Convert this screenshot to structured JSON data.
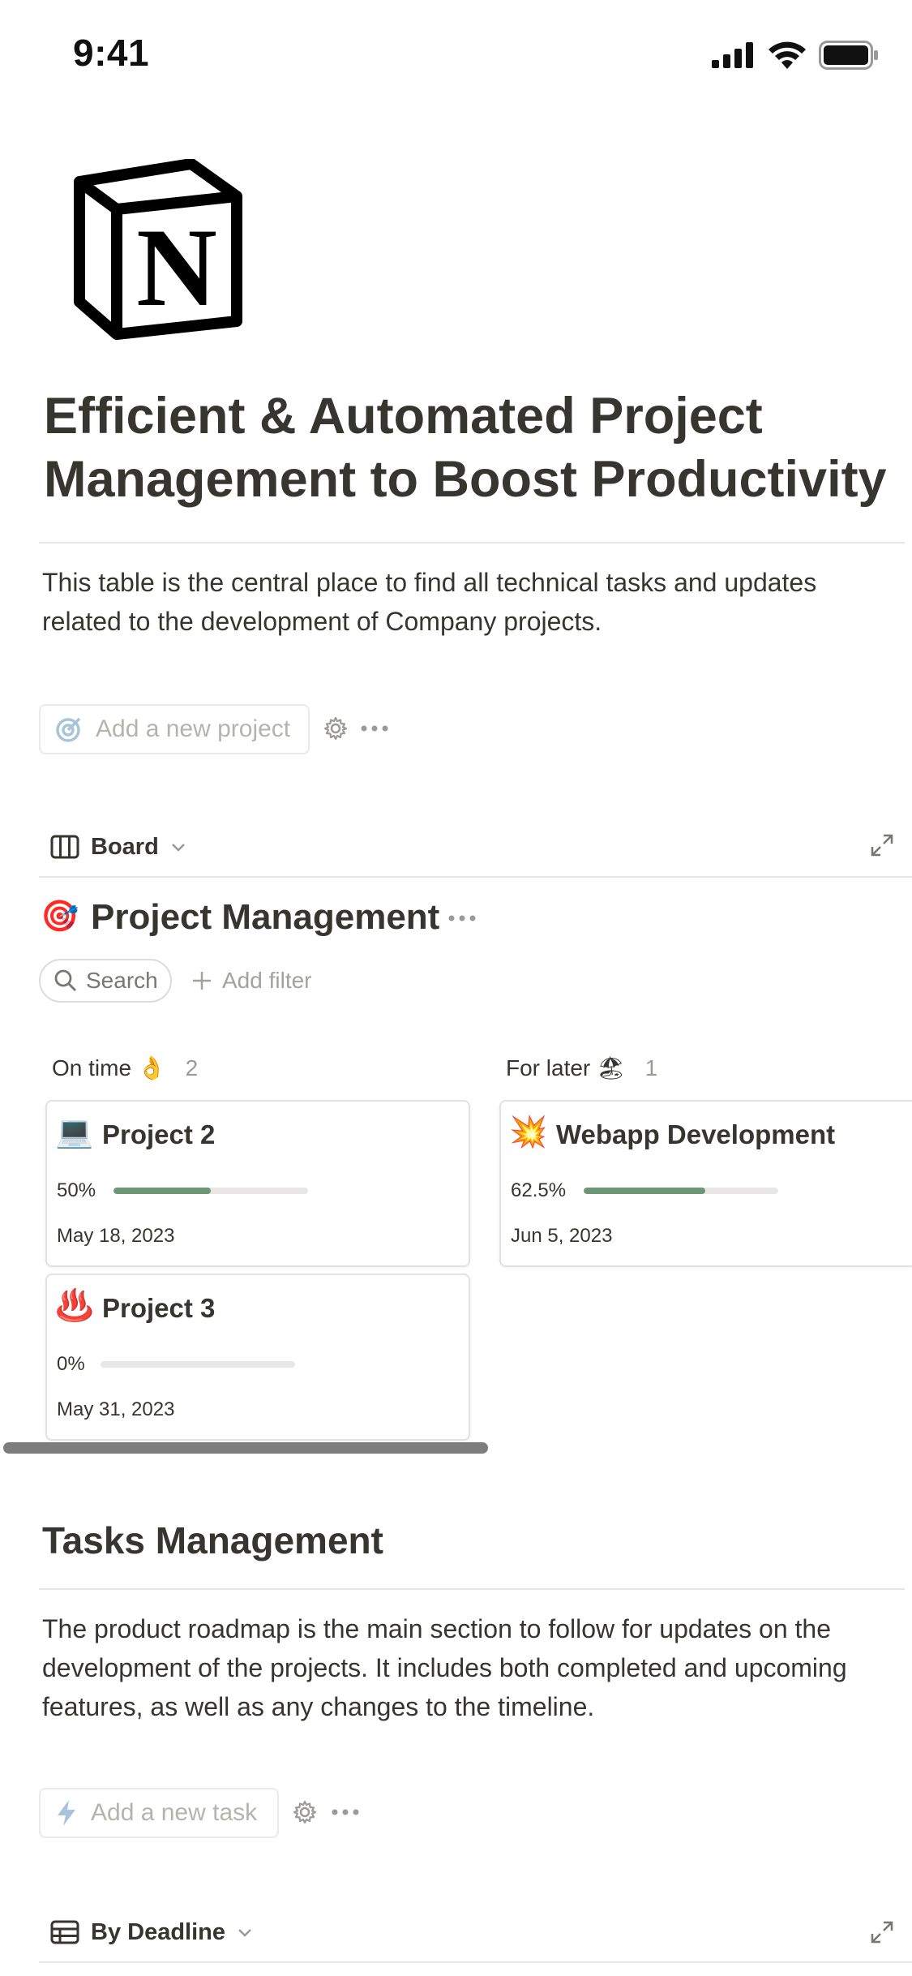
{
  "status_bar": {
    "time": "9:41"
  },
  "page": {
    "title": "Efficient & Automated Project Management to Boost Productivity",
    "description": "This table is the central place to find all technical tasks and updates related to the development of Company projects."
  },
  "projects_actions": {
    "add_label": "Add a new project"
  },
  "board_view": {
    "view_label": "Board",
    "db_icon": "🎯",
    "db_title": "Project Management",
    "search_label": "Search",
    "filter_label": "Add filter",
    "columns": [
      {
        "name": "On time 👌",
        "count": "2",
        "cards": [
          {
            "icon": "💻",
            "title": "Project 2",
            "percent_label": "50%",
            "progress": 0.5,
            "date": "May 18, 2023"
          },
          {
            "icon": "♨️",
            "title": "Project 3",
            "percent_label": "0%",
            "progress": 0,
            "date": "May 31, 2023"
          }
        ]
      },
      {
        "name": "For later 🏖",
        "count": "1",
        "cards": [
          {
            "icon": "💥",
            "title": "Webapp Development",
            "percent_label": "62.5%",
            "progress": 0.625,
            "date": "Jun 5, 2023"
          }
        ]
      }
    ]
  },
  "tasks": {
    "heading": "Tasks Management",
    "description": "The product roadmap is the main section to follow for updates on the development of the projects. It includes both completed and upcoming features, as well as any changes to the timeline.",
    "add_label": "Add a new task",
    "view_label": "By Deadline"
  },
  "colors": {
    "progress": "#6d9677",
    "text": "#37352f",
    "muted": "#9b9a97"
  },
  "icons": [
    "signal-icon",
    "wifi-icon",
    "battery-icon",
    "notion-logo",
    "target-icon",
    "gear-icon",
    "more-icon",
    "board-icon",
    "expand-icon",
    "search-icon",
    "plus-icon",
    "lightning-icon",
    "table-icon"
  ]
}
